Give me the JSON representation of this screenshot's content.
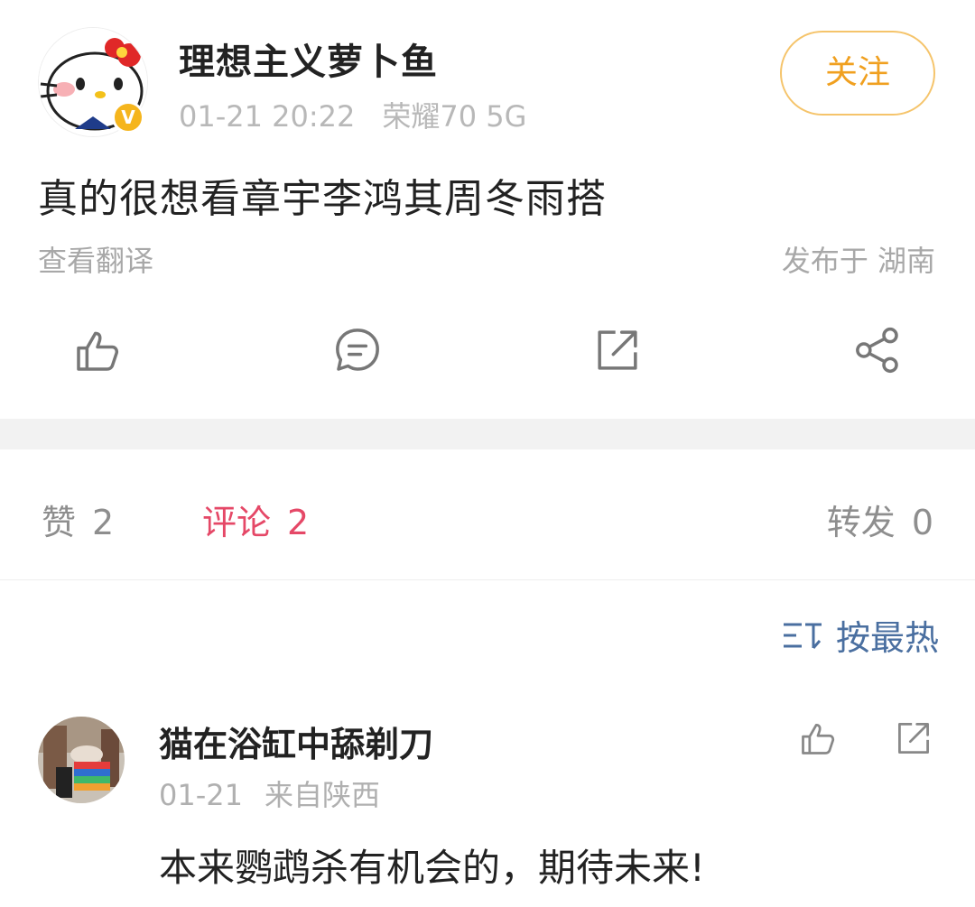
{
  "post": {
    "author": {
      "name": "理想主义萝卜鱼",
      "verified_badge": "V"
    },
    "date": "01-21 20:22",
    "device": "荣耀70 5G",
    "follow_label": "关注",
    "text": "真的很想看章宇李鸿其周冬雨搭",
    "translate_label": "查看翻译",
    "location": "发布于 湖南",
    "actions": [
      {
        "icon": "like-icon"
      },
      {
        "icon": "comment-icon"
      },
      {
        "icon": "repost-icon"
      },
      {
        "icon": "share-icon"
      }
    ]
  },
  "tabs": {
    "likes": {
      "label": "赞",
      "count": "2"
    },
    "comments": {
      "label": "评论",
      "count": "2"
    },
    "reposts": {
      "label": "转发",
      "count": "0"
    }
  },
  "sort": {
    "label": "按最热",
    "icon": "sort-icon"
  },
  "comments": [
    {
      "user": "猫在浴缸中舔剃刀",
      "date": "01-21",
      "location": "来自陕西",
      "text": "本来鹦鹉杀有机会的，期待未来!"
    }
  ],
  "colors": {
    "accent_follow": "#f0a020",
    "active_tab": "#e54867",
    "sort_link": "#4a6fa0",
    "verified": "#f5b51d"
  }
}
